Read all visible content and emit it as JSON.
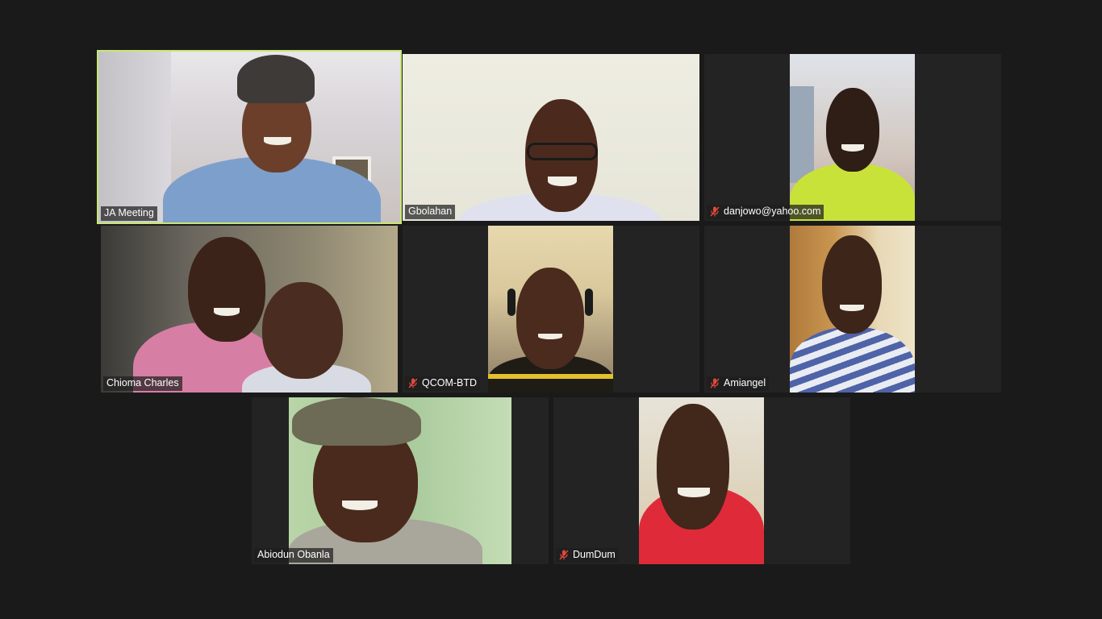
{
  "participants": [
    {
      "name": "JA Meeting",
      "muted": false,
      "active": true
    },
    {
      "name": "Gbolahan",
      "muted": false,
      "active": false
    },
    {
      "name": "danjowo@yahoo.com",
      "muted": true,
      "active": false
    },
    {
      "name": "Chioma Charles",
      "muted": false,
      "active": false
    },
    {
      "name": "QCOM-BTD",
      "muted": true,
      "active": false
    },
    {
      "name": "Amiangel",
      "muted": true,
      "active": false
    },
    {
      "name": "Abiodun Obanla",
      "muted": false,
      "active": false
    },
    {
      "name": "DumDum",
      "muted": true,
      "active": false
    }
  ],
  "colors": {
    "background": "#1a1a1a",
    "tile": "#232323",
    "active_speaker_border": "#c8e676",
    "muted_icon": "#e0483b"
  },
  "icons": {
    "muted": "microphone-muted-icon"
  }
}
